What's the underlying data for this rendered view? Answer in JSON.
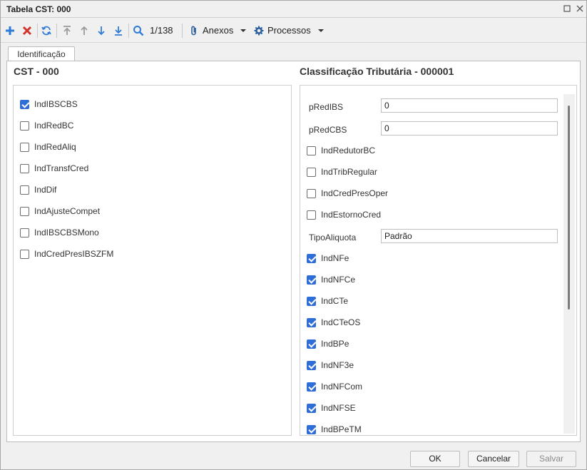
{
  "window": {
    "title": "Tabela CST: 000"
  },
  "toolbar": {
    "record_counter": "1/138",
    "anexos_label": "Anexos",
    "processos_label": "Processos"
  },
  "tabs": [
    {
      "label": "Identificação",
      "active": true
    }
  ],
  "left_section": {
    "title": "CST - 000",
    "checkboxes": [
      {
        "label": "IndIBSCBS",
        "checked": true
      },
      {
        "label": "IndRedBC",
        "checked": false
      },
      {
        "label": "IndRedAliq",
        "checked": false
      },
      {
        "label": "IndTransfCred",
        "checked": false
      },
      {
        "label": "IndDif",
        "checked": false
      },
      {
        "label": "IndAjusteCompet",
        "checked": false
      },
      {
        "label": "IndIBSCBSMono",
        "checked": false
      },
      {
        "label": "IndCredPresIBSZFM",
        "checked": false
      }
    ]
  },
  "right_section": {
    "title": "Classificação Tributária - 000001",
    "fields": {
      "pRedIBS": {
        "label": "pRedIBS",
        "value": "0"
      },
      "pRedCBS": {
        "label": "pRedCBS",
        "value": "0"
      },
      "TipoAliquota": {
        "label": "TipoAliquota",
        "value": "Padrão"
      }
    },
    "checkboxes_a": [
      {
        "label": "IndRedutorBC",
        "checked": false
      },
      {
        "label": "IndTribRegular",
        "checked": false
      },
      {
        "label": "IndCredPresOper",
        "checked": false
      },
      {
        "label": "IndEstornoCred",
        "checked": false
      }
    ],
    "checkboxes_b": [
      {
        "label": "IndNFe",
        "checked": true
      },
      {
        "label": "IndNFCe",
        "checked": true
      },
      {
        "label": "IndCTe",
        "checked": true
      },
      {
        "label": "IndCTeOS",
        "checked": true
      },
      {
        "label": "IndBPe",
        "checked": true
      },
      {
        "label": "IndNF3e",
        "checked": true
      },
      {
        "label": "IndNFCom",
        "checked": true
      },
      {
        "label": "IndNFSE",
        "checked": true
      },
      {
        "label": "IndBPeTM",
        "checked": true
      }
    ]
  },
  "footer": {
    "ok_label": "OK",
    "cancel_label": "Cancelar",
    "save_label": "Salvar"
  },
  "colors": {
    "accent": "#2f6ed6",
    "add": "#2e7bd6",
    "delete": "#d0342c"
  }
}
